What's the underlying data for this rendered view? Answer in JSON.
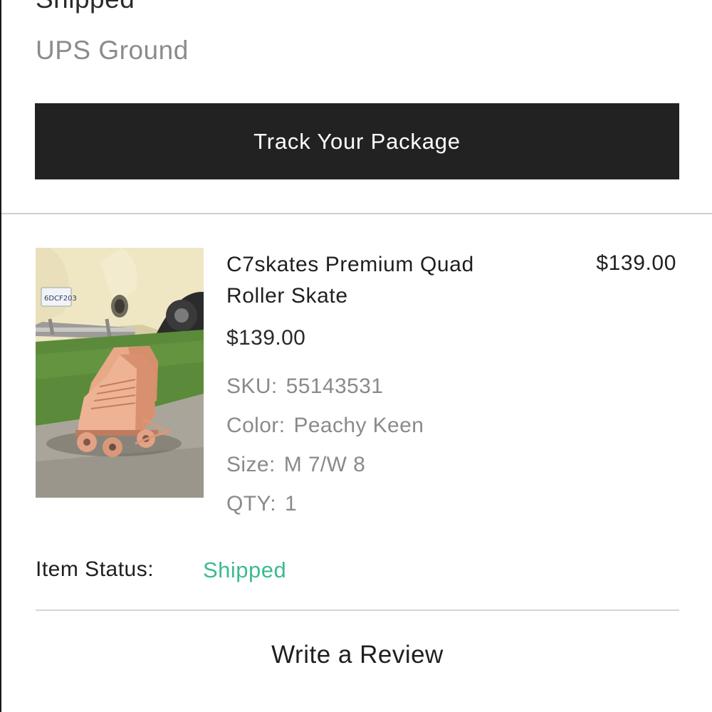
{
  "shipment": {
    "status_heading": "Shipped",
    "carrier": "UPS Ground",
    "track_button_label": "Track Your Package"
  },
  "item": {
    "name": "C7skates Premium Quad Roller Skate",
    "total_price": "$139.00",
    "unit_price": "$139.00",
    "sku_label": "SKU:",
    "sku_value": "55143531",
    "color_label": "Color:",
    "color_value": "Peachy Keen",
    "size_label": "Size:",
    "size_value": "M 7/W 8",
    "qty_label": "QTY:",
    "qty_value": "1",
    "status_label": "Item Status:",
    "status_value": "Shipped",
    "plate_text": "6DCF203"
  },
  "actions": {
    "review_label": "Write a Review"
  },
  "colors": {
    "button_bg": "#222222",
    "status_green": "#3dbb8e",
    "muted_text": "#8a8a8a"
  }
}
